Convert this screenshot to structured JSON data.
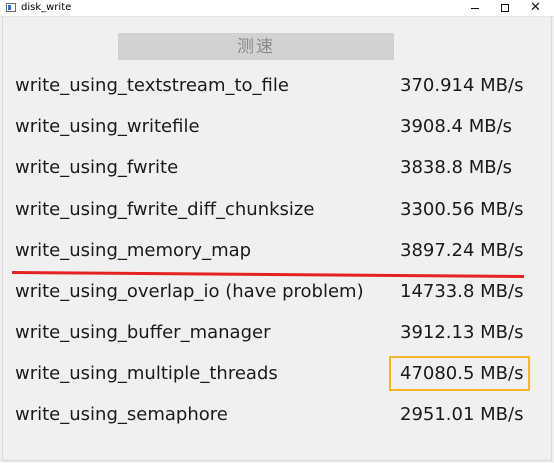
{
  "window": {
    "title": "disk_write",
    "minimize_glyph": "minimize-icon",
    "maximize_glyph": "maximize-icon",
    "close_glyph": "✕"
  },
  "test_button": {
    "label": "测速"
  },
  "results": [
    {
      "label": "write_using_textstream_to_file",
      "value": "370.914 MB/s"
    },
    {
      "label": "write_using_writefile",
      "value": "3908.4 MB/s"
    },
    {
      "label": "write_using_fwrite",
      "value": "3838.8 MB/s"
    },
    {
      "label": "write_using_fwrite_diff_chunksize",
      "value": "3300.56 MB/s"
    },
    {
      "label": "write_using_memory_map",
      "value": "3897.24 MB/s"
    },
    {
      "label": "write_using_overlap_io  (have problem)",
      "value": "14733.8 MB/s"
    },
    {
      "label": "write_using_buffer_manager",
      "value": "3912.13 MB/s"
    },
    {
      "label": "write_using_multiple_threads",
      "value": "47080.5 MB/s"
    },
    {
      "label": "write_using_semaphore",
      "value": "2951.01 MB/s"
    }
  ],
  "annotations": {
    "strike_color": "#e52222",
    "highlight_color": "#f5b52a"
  }
}
